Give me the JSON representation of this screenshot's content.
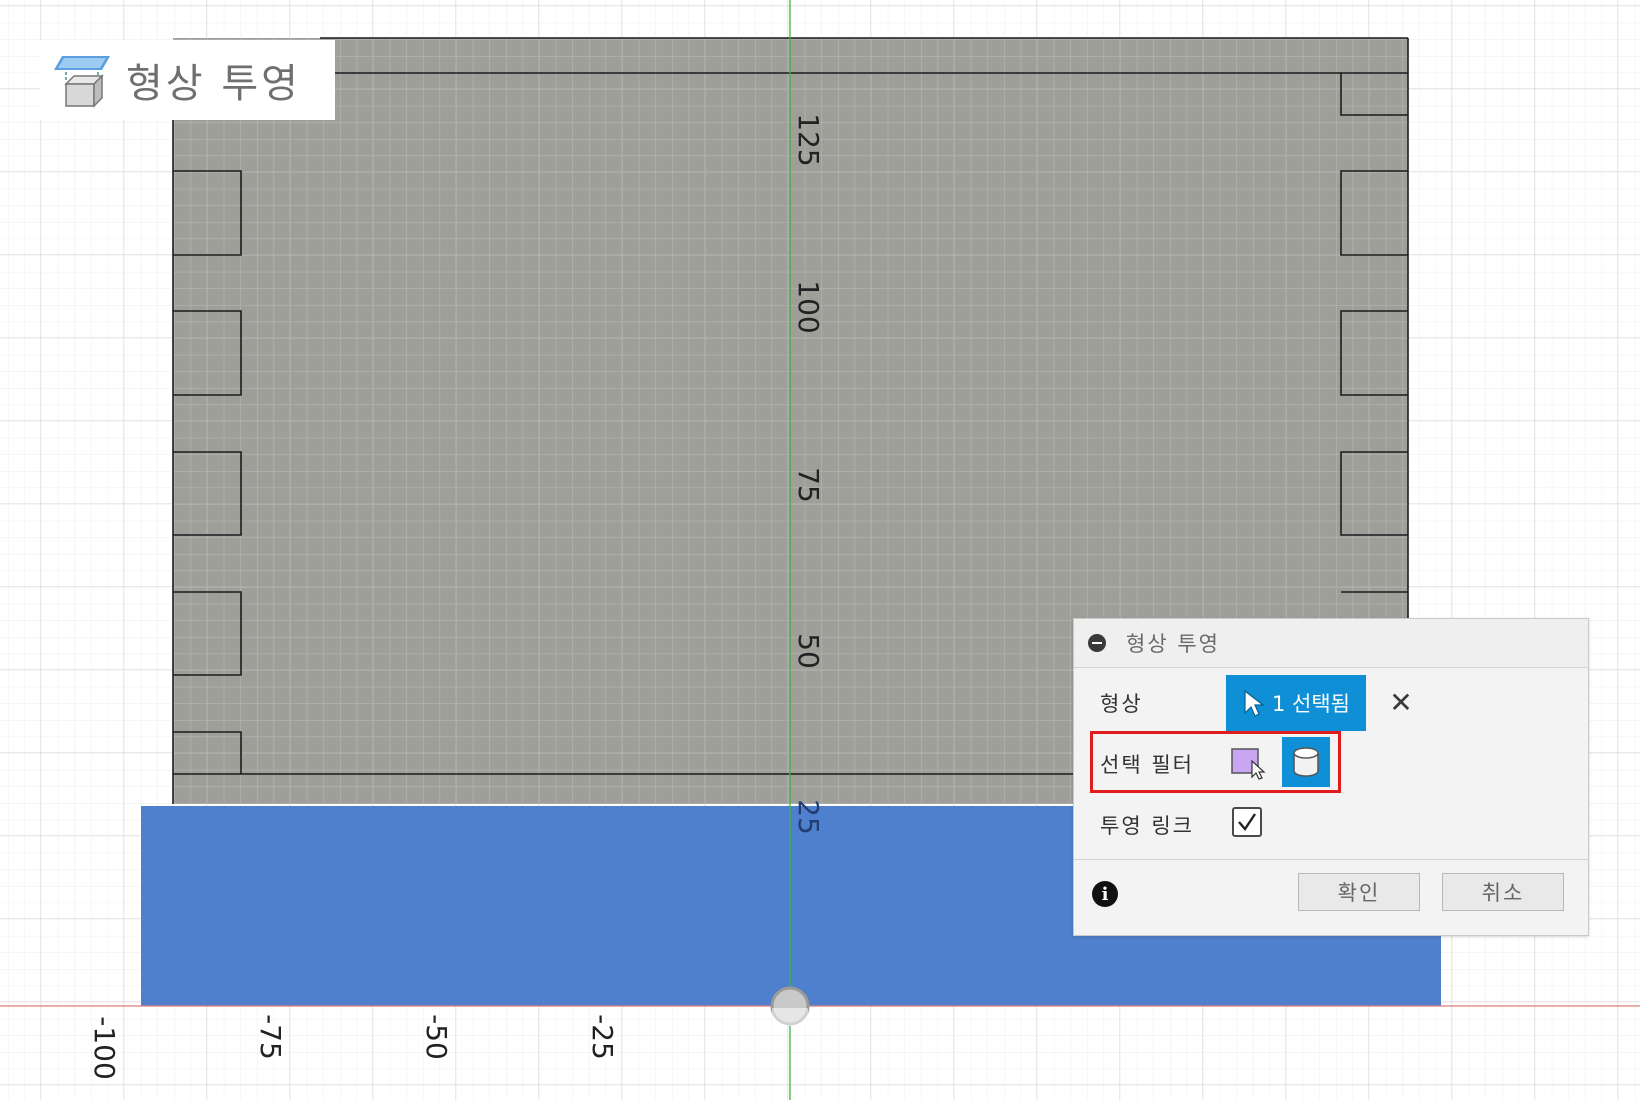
{
  "command": {
    "title": "형상 투영",
    "icon": "project-geometry-icon"
  },
  "viewport": {
    "y_axis_ticks": [
      "125",
      "100",
      "75",
      "50",
      "25"
    ],
    "x_axis_ticks": [
      "-100",
      "-75",
      "-50",
      "-25"
    ],
    "colors": {
      "sketch_plane": "#9c9c97",
      "selected_body": "#4f80cd",
      "grid": "#e4e4e4",
      "y_axis": "#3db53d",
      "x_axis": "#e07a7a"
    }
  },
  "dialog": {
    "title": "형상 투영",
    "geometry_label": "형상",
    "selection_button": "1 선택됨",
    "selection_filter_label": "선택 필터",
    "projection_link_label": "투영 링크",
    "projection_link_checked": true,
    "ok_button": "확인",
    "cancel_button": "취소",
    "accent_color": "#0e8fd6",
    "highlight_color": "#e01c1c"
  }
}
